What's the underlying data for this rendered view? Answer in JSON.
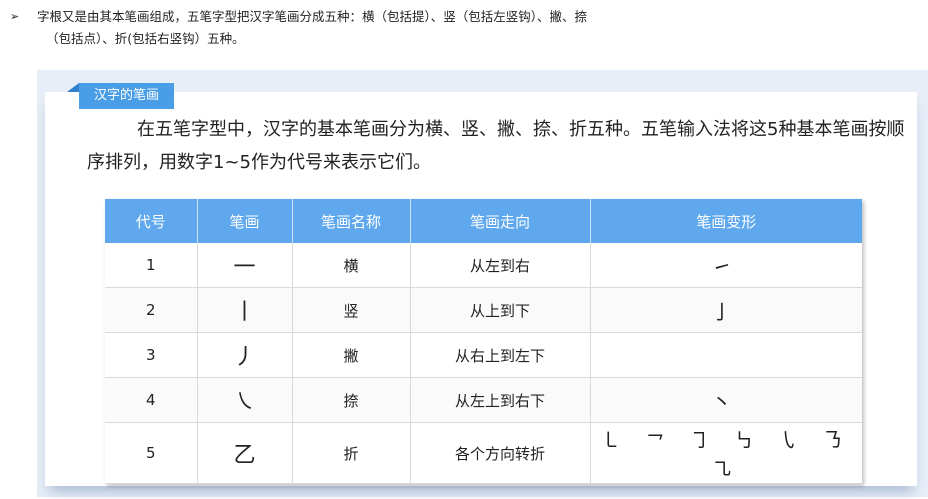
{
  "intro": {
    "bullet": "➢",
    "line1": "字根又是由其本笔画组成，五笔字型把汉字笔画分成五种：横（包括提）、竖（包括左竖钩）、撇、捺",
    "line2": "（包括点）、折(包括右竖钩）五种。"
  },
  "card": {
    "tag": "汉字的笔画",
    "paragraph": "在五笔字型中，汉字的基本笔画分为横、竖、撇、捺、折五种。五笔输入法将这5种基本笔画按顺序排列，用数字1~5作为代号来表示它们。"
  },
  "table": {
    "headers": [
      "代号",
      "笔画",
      "笔画名称",
      "笔画走向",
      "笔画变形"
    ],
    "rows": [
      {
        "code": "1",
        "stroke": "一",
        "name": "横",
        "direction": "从左到右",
        "variants": "㇀"
      },
      {
        "code": "2",
        "stroke": "丨",
        "name": "竖",
        "direction": "从上到下",
        "variants": "亅"
      },
      {
        "code": "3",
        "stroke": "丿",
        "name": "撇",
        "direction": "从右上到左下",
        "variants": ""
      },
      {
        "code": "4",
        "stroke": "㇏",
        "name": "捺",
        "direction": "从左上到右下",
        "variants": "丶"
      },
      {
        "code": "5",
        "stroke": "乙",
        "name": "折",
        "direction": "各个方向转折",
        "variants": "㇄ ㇖ ㇆ ㇉ ㇂ ㇡ ㇈"
      }
    ]
  }
}
